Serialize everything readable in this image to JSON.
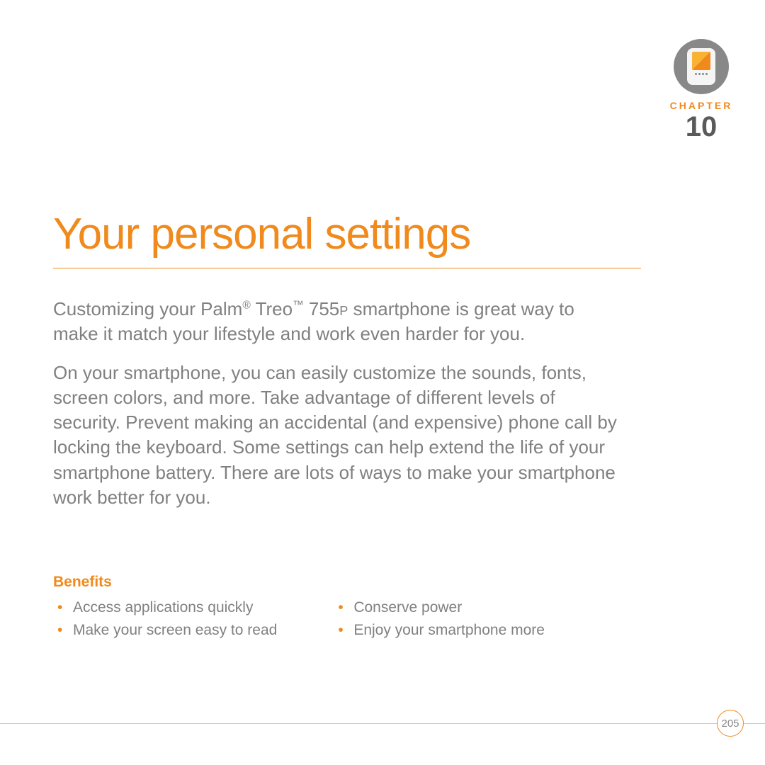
{
  "chapter": {
    "label": "CHAPTER",
    "number": "10"
  },
  "title": "Your personal settings",
  "intro": {
    "p1_pre": "Customizing your Palm",
    "p1_mid1": " Treo",
    "p1_mid2": " 755",
    "p1_post": " smartphone is great way to make it match your lifestyle and work even harder for you.",
    "p2": "On your smartphone, you can easily customize the sounds, fonts, screen colors, and more. Take advantage of different levels of security. Prevent making an accidental (and expensive) phone call by locking the keyboard. Some settings can help extend the life of your smartphone battery. There are lots of ways to make your smartphone work better for you."
  },
  "benefits": {
    "heading": "Benefits",
    "col1": [
      "Access applications quickly",
      "Make your screen easy to read"
    ],
    "col2": [
      "Conserve power",
      "Enjoy your smartphone more"
    ]
  },
  "page_number": "205"
}
